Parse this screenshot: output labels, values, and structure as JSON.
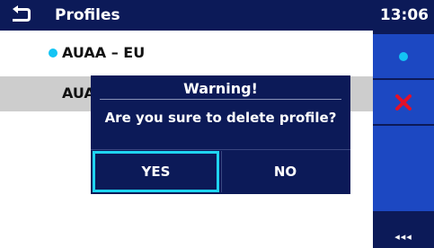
{
  "header": {
    "title": "Profiles",
    "clock": "13:06",
    "back_icon": "back-arrow-icon"
  },
  "profiles": [
    {
      "label": "AUAA – EU",
      "active": true
    },
    {
      "label": "AUA",
      "active": false,
      "selected": true
    }
  ],
  "sidebar": {
    "buttons": [
      {
        "icon": "active-dot-icon",
        "color": "#13c4f4"
      },
      {
        "icon": "delete-x-icon",
        "color": "#e0102a"
      },
      {
        "icon": "empty"
      }
    ],
    "more_label": "◂◂◂"
  },
  "dialog": {
    "title": "Warning!",
    "message": "Are you sure to delete profile?",
    "yes_label": "YES",
    "no_label": "NO"
  },
  "colors": {
    "header_bg": "#0c1a58",
    "sidebar_button": "#1c48c2",
    "accent": "#1fd4f0",
    "selected_row": "#cdcdcd"
  }
}
